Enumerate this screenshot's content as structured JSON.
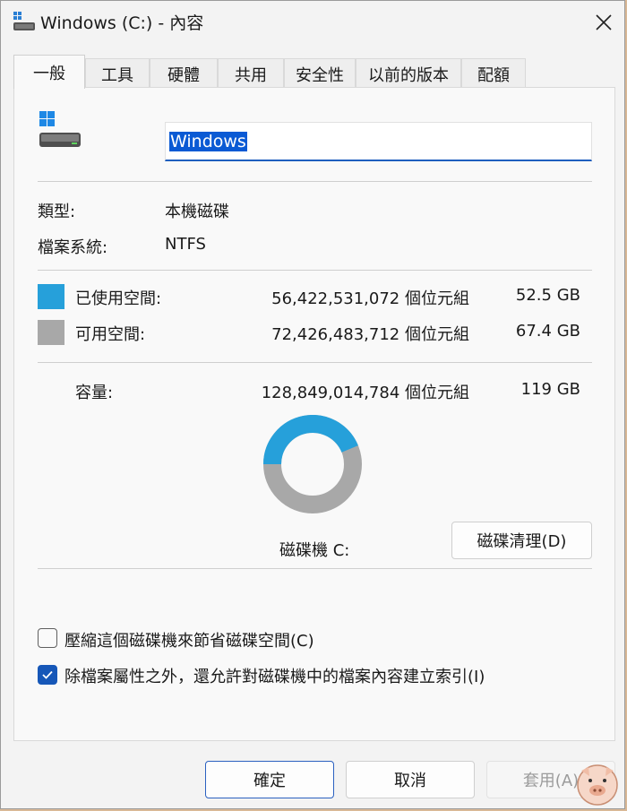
{
  "window": {
    "title": "Windows (C:) - 內容"
  },
  "tabs": [
    {
      "label": "一般",
      "active": true
    },
    {
      "label": "工具"
    },
    {
      "label": "硬體"
    },
    {
      "label": "共用"
    },
    {
      "label": "安全性"
    },
    {
      "label": "以前的版本"
    },
    {
      "label": "配額"
    }
  ],
  "general": {
    "volume_name": "Windows",
    "type_label": "類型:",
    "type_value": "本機磁碟",
    "fs_label": "檔案系統:",
    "fs_value": "NTFS",
    "used_label": "已使用空間:",
    "used_bytes": "56,422,531,072 個位元組",
    "used_size": "52.5 GB",
    "free_label": "可用空間:",
    "free_bytes": "72,426,483,712 個位元組",
    "free_size": "67.4 GB",
    "capacity_label": "容量:",
    "capacity_bytes": "128,849,014,784 個位元組",
    "capacity_size": "119 GB",
    "drive_label": "磁碟機 C:",
    "cleanup_button": "磁碟清理(D)",
    "compress_label": "壓縮這個磁碟機來節省磁碟空間(C)",
    "compress_checked": false,
    "index_label": "除檔案屬性之外，還允許對磁碟機中的檔案內容建立索引(I)",
    "index_checked": true
  },
  "usage_fraction": 0.438,
  "colors": {
    "used": "#26a0da",
    "free": "#a8a8a8",
    "accent": "#1657b8"
  },
  "footer": {
    "ok": "確定",
    "cancel": "取消",
    "apply": "套用(A)"
  }
}
